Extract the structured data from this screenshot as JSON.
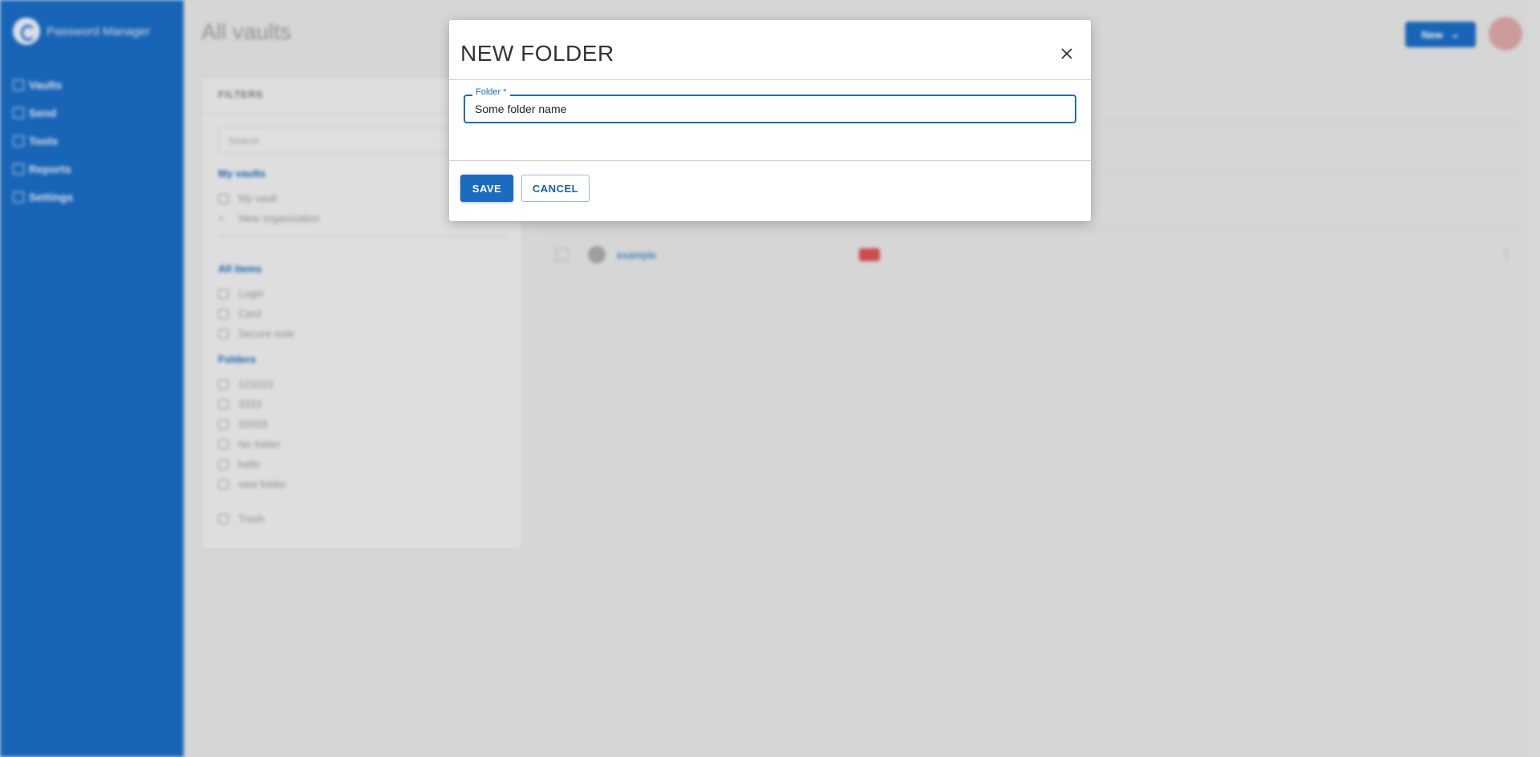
{
  "app": {
    "brand": "Password Manager"
  },
  "sidebar": {
    "items": [
      {
        "label": "Vaults",
        "icon": "vault-icon"
      },
      {
        "label": "Send",
        "icon": "send-icon"
      },
      {
        "label": "Tools",
        "icon": "wrench-icon"
      },
      {
        "label": "Reports",
        "icon": "reports-icon"
      },
      {
        "label": "Settings",
        "icon": "gear-icon"
      }
    ]
  },
  "header": {
    "title": "All vaults",
    "new_button": "New"
  },
  "filters": {
    "title": "FILTERS",
    "search_placeholder": "Search",
    "vaults": {
      "heading": "My vaults",
      "items": [
        "My vault",
        "New organization"
      ]
    },
    "types": {
      "heading": "All items",
      "items": [
        "Login",
        "Card",
        "Secure note"
      ]
    },
    "folders": {
      "heading": "Folders",
      "items": [
        "123123",
        "3333",
        "33333",
        "No folder",
        "hello",
        "new folder"
      ]
    },
    "trash": "Trash"
  },
  "vault_list": {
    "rows": [
      {
        "name": "example"
      }
    ]
  },
  "modal": {
    "title": "NEW FOLDER",
    "field_label": "Folder *",
    "field_value": "Some folder name",
    "save_label": "SAVE",
    "cancel_label": "CANCEL"
  },
  "colors": {
    "primary": "#1a6bc2",
    "sidebar": "#1a6bc2",
    "backdrop": "#e4e4e4",
    "badge": "#d9534f"
  }
}
